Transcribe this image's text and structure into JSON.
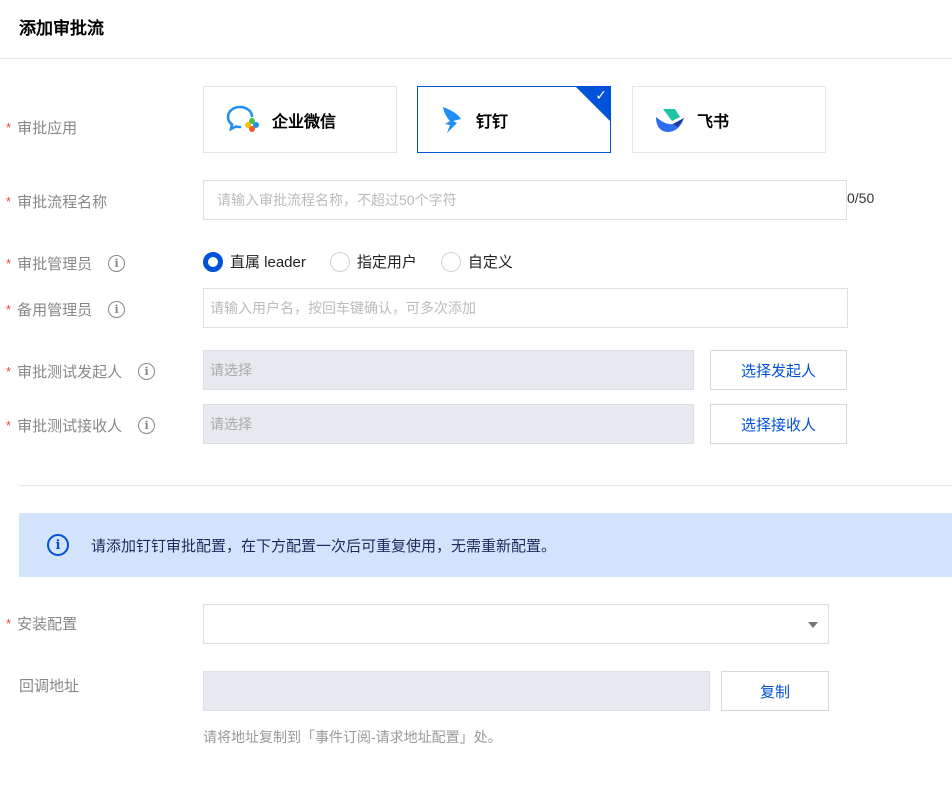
{
  "title": "添加审批流",
  "labels": {
    "app": "审批应用",
    "name": "审批流程名称",
    "admin": "审批管理员",
    "backup_admin": "备用管理员",
    "test_sender": "审批测试发起人",
    "test_receiver": "审批测试接收人",
    "install": "安装配置",
    "callback": "回调地址"
  },
  "required_mark": "*",
  "info_glyph": "i",
  "apps": [
    {
      "label": "企业微信",
      "icon": "wecom-icon"
    },
    {
      "label": "钉钉",
      "icon": "dingtalk-icon",
      "selected": true
    },
    {
      "label": "飞书",
      "icon": "feishu-icon"
    }
  ],
  "name_input": {
    "placeholder": "请输入审批流程名称，不超过50个字符",
    "counter": "0/50"
  },
  "admin_options": [
    {
      "label": "直属 leader",
      "checked": true
    },
    {
      "label": "指定用户",
      "checked": false
    },
    {
      "label": "自定义",
      "checked": false
    }
  ],
  "backup_input": {
    "placeholder": "请输入用户名，按回车键确认，可多次添加"
  },
  "sender": {
    "placeholder": "请选择",
    "button": "选择发起人"
  },
  "receiver": {
    "placeholder": "请选择",
    "button": "选择接收人"
  },
  "alert": "请添加钉钉审批配置，在下方配置一次后可重复使用，无需重新配置。",
  "install_select": {
    "value": ""
  },
  "callback": {
    "value": "",
    "button": "复制",
    "hint": "请将地址复制到「事件订阅-请求地址配置」处。"
  },
  "colors": {
    "primary": "#0052d9",
    "alert_bg": "#d4e3fc",
    "required": "#e54545"
  }
}
